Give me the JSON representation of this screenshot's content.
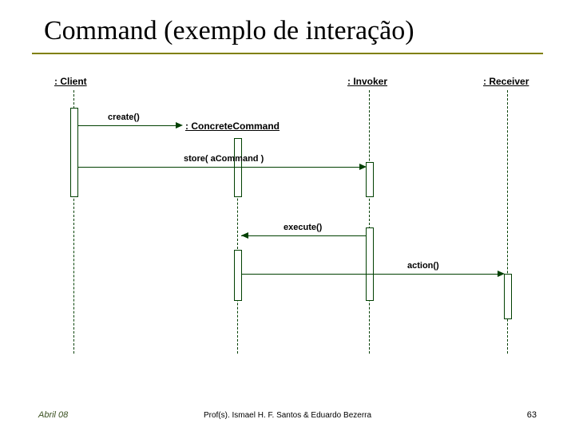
{
  "title": "Command (exemplo de interação)",
  "participants": {
    "client": ": Client",
    "invoker": ": Invoker",
    "receiver": ": Receiver",
    "concrete": ": ConcreteCommand"
  },
  "messages": {
    "create": "create()",
    "store": "store( aCommand )",
    "execute": "execute()",
    "action": "action()"
  },
  "footer": {
    "left": "Abril 08",
    "center": "Prof(s). Ismael H. F. Santos & Eduardo Bezerra",
    "right": "63"
  }
}
